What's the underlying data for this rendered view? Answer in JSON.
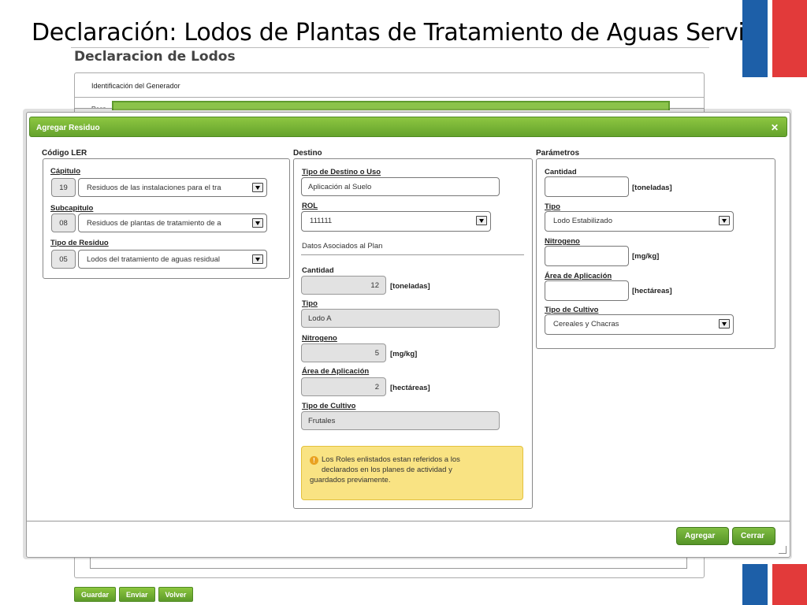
{
  "slide": {
    "title": "Declaración: Lodos de Plantas de Tratamiento de Aguas Servidas"
  },
  "background": {
    "heading": "Declaracion de Lodos",
    "identification_label": "Identificación del Generador",
    "row_label": "Resp",
    "buttons": {
      "save": "Guardar",
      "send": "Enviar",
      "back": "Volver"
    }
  },
  "modal": {
    "title": "Agregar Residuo",
    "close_icon": "close-icon",
    "codigo_ler": {
      "section_label": "Código LER",
      "capitulo": {
        "label": "Cápitulo",
        "code": "19",
        "value": "Residuos de las instalaciones para el tra"
      },
      "subcapitulo": {
        "label": "Subcapitulo",
        "code": "08",
        "value": "Residuos de plantas de tratamiento de a"
      },
      "tipo_residuo": {
        "label": "Tipo de Residuo",
        "code": "05",
        "value": "Lodos del tratamiento de aguas residual"
      }
    },
    "destino": {
      "section_label": "Destino",
      "tipo_destino": {
        "label": "Tipo de Destino o Uso",
        "value": "Aplicación al Suelo"
      },
      "rol": {
        "label": "ROL",
        "value": "111111"
      },
      "plan_header": "Datos Asociados al Plan",
      "cantidad": {
        "label": "Cantidad",
        "value": "12",
        "unit": "[toneladas]"
      },
      "tipo": {
        "label": "Tipo",
        "value": "Lodo A"
      },
      "nitrogeno": {
        "label": "Nitrogeno",
        "value": "5",
        "unit": "[mg/kg]"
      },
      "area": {
        "label": "Área de Aplicación",
        "value": "2",
        "unit": "[hectáreas]"
      },
      "cultivo": {
        "label": "Tipo de Cultivo",
        "value": "Frutales"
      },
      "info_line1": "Los Roles enlistados estan referidos a los",
      "info_line2": "declarados en los planes de actividad y",
      "info_line3": "guardados previamente."
    },
    "parametros": {
      "section_label": "Parámetros",
      "cantidad": {
        "label": "Cantidad",
        "value": "",
        "unit": "[toneladas]"
      },
      "tipo": {
        "label": "Tipo",
        "value": "Lodo Estabilizado"
      },
      "nitrogeno": {
        "label": "Nitrogeno",
        "value": "",
        "unit": "[mg/kg]"
      },
      "area": {
        "label": "Área de Aplicación",
        "value": "",
        "unit": "[hectáreas]"
      },
      "cultivo": {
        "label": "Tipo de Cultivo",
        "value": "Cereales y Chacras"
      }
    },
    "buttons": {
      "add": "Agregar",
      "close": "Cerrar"
    }
  },
  "colors": {
    "accent_green": "#65a32c",
    "flag_blue": "#1d5fa8",
    "flag_red": "#e23a3a",
    "info_yellow": "#f9e383"
  }
}
